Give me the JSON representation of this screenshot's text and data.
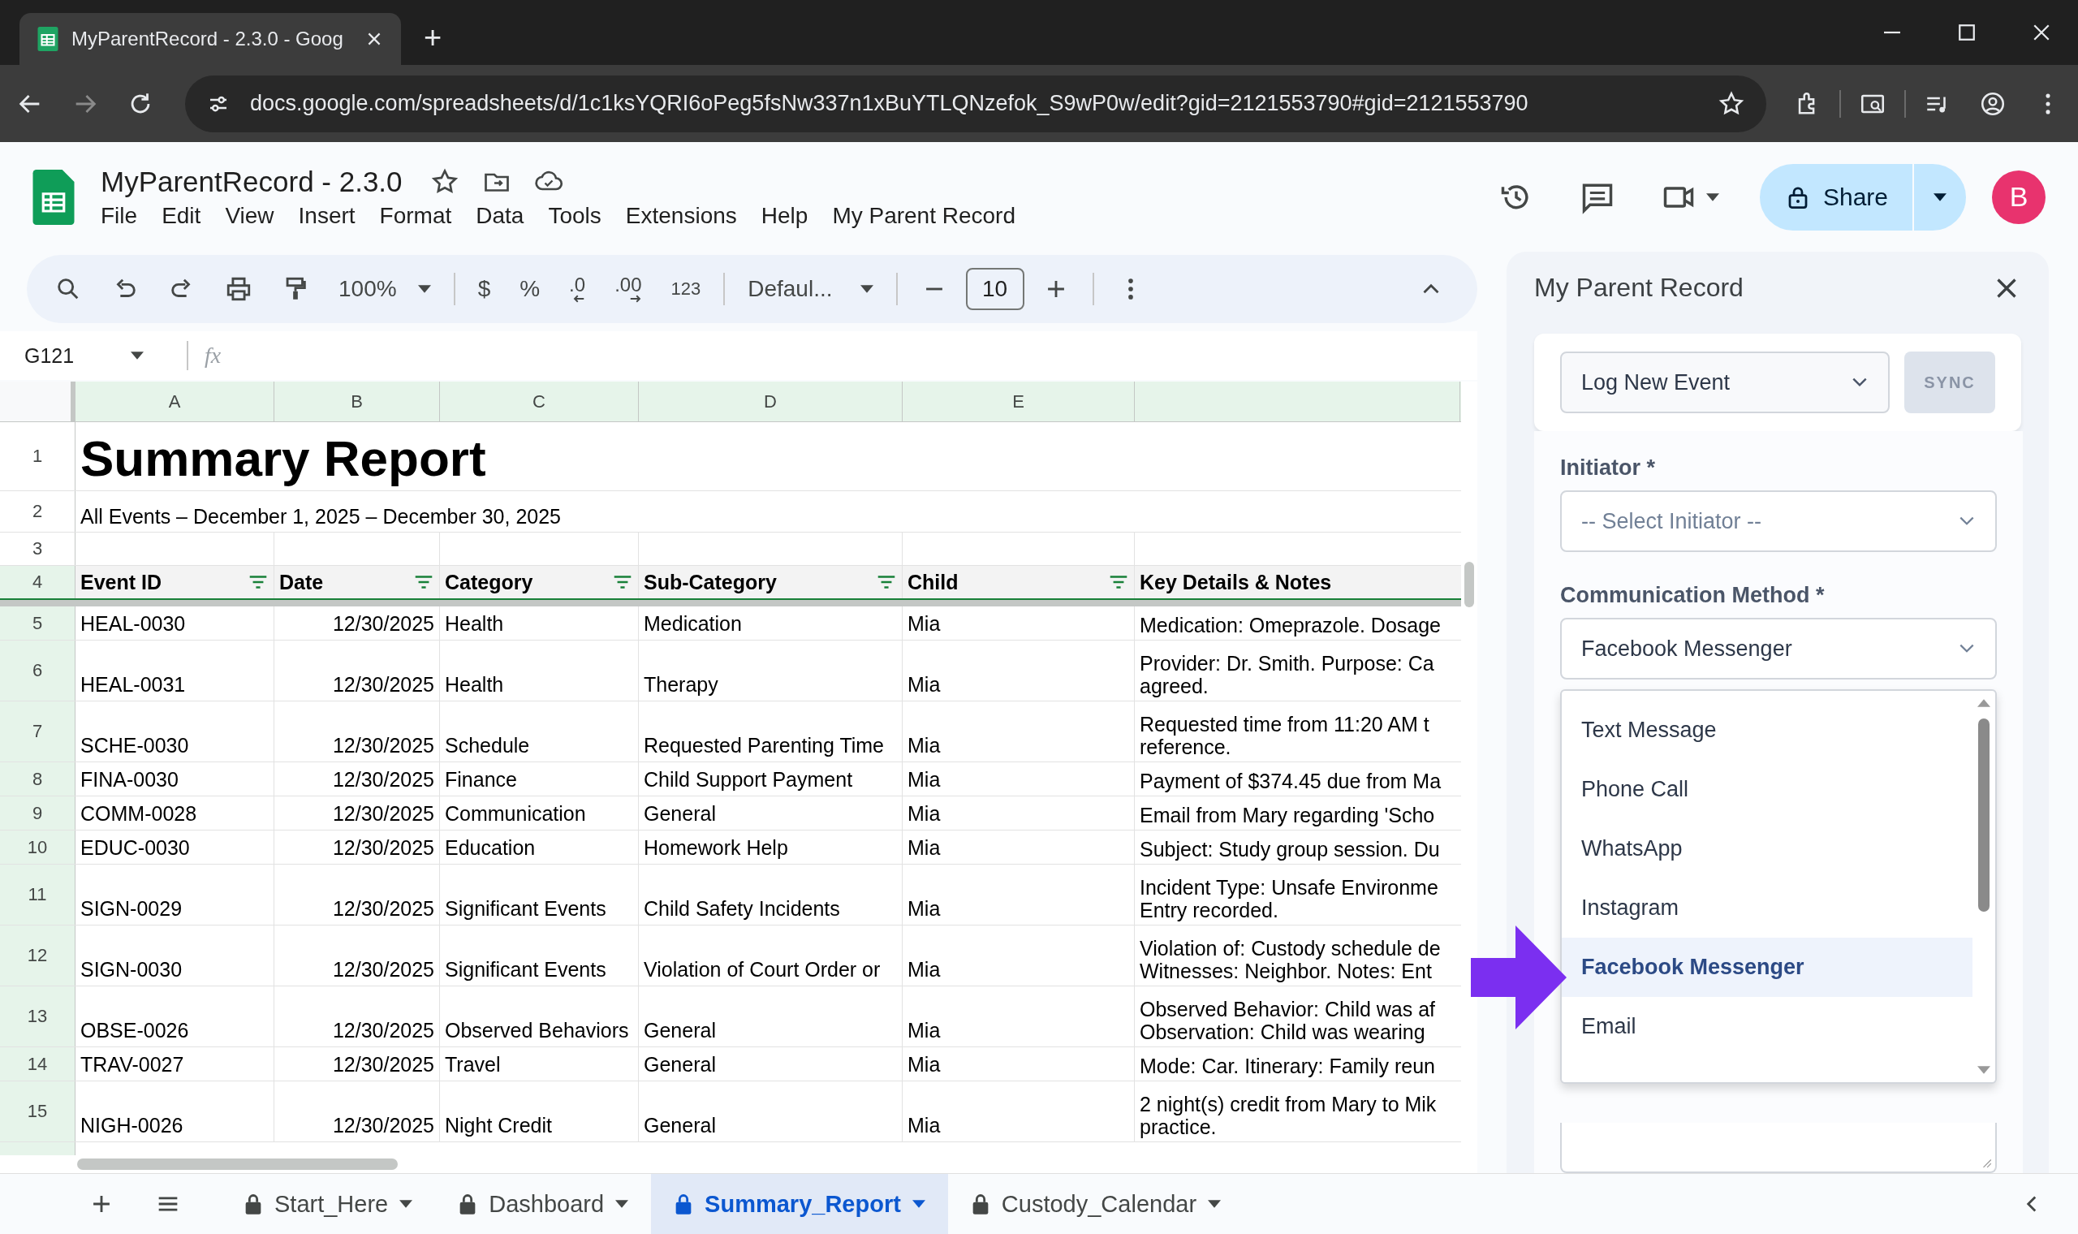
{
  "browser": {
    "tab_title": "MyParentRecord - 2.3.0 - Goog",
    "new_tab": "+",
    "url": "docs.google.com/spreadsheets/d/1c1ksYQRI6oPeg5fsNw337n1xBuYTLQNzefok_S9wP0w/edit?gid=2121553790#gid=2121553790"
  },
  "document": {
    "title": "MyParentRecord - 2.3.0",
    "menus": [
      "File",
      "Edit",
      "View",
      "Insert",
      "Format",
      "Data",
      "Tools",
      "Extensions",
      "Help",
      "My Parent Record"
    ],
    "share": "Share",
    "avatar": "B"
  },
  "toolbar": {
    "zoom": "100%",
    "currency": "$",
    "percent": "%",
    "decrease_decimal": ".0",
    "increase_decimal": ".00",
    "number_format": "123",
    "font": "Defaul...",
    "font_size": "10"
  },
  "formula_bar": {
    "cell_ref": "G121",
    "fx": "fx"
  },
  "sheet": {
    "columns": [
      "A",
      "B",
      "C",
      "D",
      "E"
    ],
    "rows": [
      {
        "number": "1",
        "kind": "title",
        "text": "Summary Report"
      },
      {
        "number": "2",
        "kind": "subtitle",
        "text": "All Events – December 1, 2025 – December 30, 2025"
      },
      {
        "number": "3",
        "kind": "blank"
      },
      {
        "number": "4",
        "kind": "header",
        "cells": [
          "Event ID",
          "Date",
          "Category",
          "Sub-Category",
          "Child"
        ],
        "notes": [
          "Key Details & Notes"
        ]
      },
      {
        "number": "5",
        "kind": "data",
        "cells": [
          "HEAL-0030",
          "12/30/2025",
          "Health",
          "Medication",
          "Mia"
        ],
        "notes": [
          "Medication: Omeprazole. Dosage"
        ]
      },
      {
        "number": "6",
        "kind": "data",
        "cells": [
          "HEAL-0031",
          "12/30/2025",
          "Health",
          "Therapy",
          "Mia"
        ],
        "notes": [
          "Provider: Dr. Smith. Purpose: Ca",
          "agreed."
        ]
      },
      {
        "number": "7",
        "kind": "data",
        "cells": [
          "SCHE-0030",
          "12/30/2025",
          "Schedule",
          "Requested Parenting Time",
          "Mia"
        ],
        "notes": [
          "Requested time from 11:20 AM t",
          "reference."
        ]
      },
      {
        "number": "8",
        "kind": "data",
        "cells": [
          "FINA-0030",
          "12/30/2025",
          "Finance",
          "Child Support Payment",
          "Mia"
        ],
        "notes": [
          "Payment of $374.45 due from Ma"
        ]
      },
      {
        "number": "9",
        "kind": "data",
        "cells": [
          "COMM-0028",
          "12/30/2025",
          "Communication",
          "General",
          "Mia"
        ],
        "notes": [
          "Email from Mary regarding 'Scho"
        ]
      },
      {
        "number": "10",
        "kind": "data",
        "cells": [
          "EDUC-0030",
          "12/30/2025",
          "Education",
          "Homework Help",
          "Mia"
        ],
        "notes": [
          "Subject: Study group session. Du"
        ]
      },
      {
        "number": "11",
        "kind": "data",
        "cells": [
          "SIGN-0029",
          "12/30/2025",
          "Significant Events",
          "Child Safety Incidents",
          "Mia"
        ],
        "notes": [
          "Incident Type: Unsafe Environme",
          "Entry recorded."
        ]
      },
      {
        "number": "12",
        "kind": "data",
        "cells": [
          "SIGN-0030",
          "12/30/2025",
          "Significant Events",
          "Violation of Court Order or",
          "Mia"
        ],
        "notes": [
          "Violation of: Custody schedule de",
          "Witnesses: Neighbor. Notes: Ent"
        ]
      },
      {
        "number": "13",
        "kind": "data",
        "cells": [
          "OBSE-0026",
          "12/30/2025",
          "Observed Behaviors",
          "General",
          "Mia"
        ],
        "notes": [
          "Observed Behavior: Child was af",
          "Observation: Child was wearing"
        ]
      },
      {
        "number": "14",
        "kind": "data",
        "cells": [
          "TRAV-0027",
          "12/30/2025",
          "Travel",
          "General",
          "Mia"
        ],
        "notes": [
          "Mode: Car. Itinerary: Family reun"
        ]
      },
      {
        "number": "15",
        "kind": "data",
        "cells": [
          "NIGH-0026",
          "12/30/2025",
          "Night Credit",
          "General",
          "Mia"
        ],
        "notes": [
          "2 night(s) credit from Mary to Mik",
          "practice."
        ]
      }
    ]
  },
  "sheet_tabs": [
    {
      "label": "Start_Here",
      "selected": false
    },
    {
      "label": "Dashboard",
      "selected": false
    },
    {
      "label": "Summary_Report",
      "selected": true
    },
    {
      "label": "Custody_Calendar",
      "selected": false
    }
  ],
  "sidebar": {
    "title": "My Parent Record",
    "mode": "Log New Event",
    "sync": "SYNC",
    "initiator": {
      "label": "Initiator *",
      "placeholder": "-- Select Initiator --"
    },
    "method": {
      "label": "Communication Method *",
      "value": "Facebook Messenger",
      "expanded": true,
      "options": [
        {
          "label": "Text Message",
          "selected": false
        },
        {
          "label": "Phone Call",
          "selected": false
        },
        {
          "label": "WhatsApp",
          "selected": false
        },
        {
          "label": "Instagram",
          "selected": false
        },
        {
          "label": "Facebook Messenger",
          "selected": true
        },
        {
          "label": "Email",
          "selected": false
        }
      ]
    }
  }
}
